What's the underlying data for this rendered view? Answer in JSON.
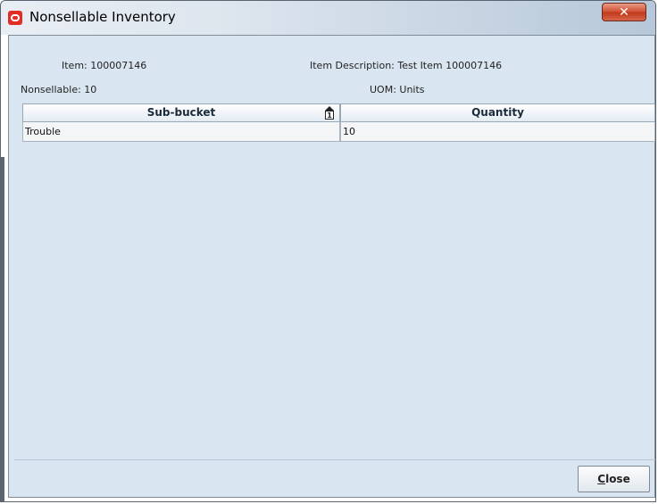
{
  "window": {
    "title": "Nonsellable Inventory",
    "close_glyph": "✕"
  },
  "fields": {
    "item_label": "Item:",
    "item_value": "100007146",
    "nonsellable_label": "Nonsellable:",
    "nonsellable_value": "10",
    "item_description_label": "Item Description:",
    "item_description_value": "Test Item 100007146",
    "uom_label": "UOM:",
    "uom_value": "Units"
  },
  "table": {
    "columns": [
      "Sub-bucket",
      "Quantity"
    ],
    "sort_indicator": "1",
    "rows": [
      {
        "sub_bucket": "Trouble",
        "quantity": "10"
      }
    ]
  },
  "footer": {
    "close_button_label": "Close",
    "close_button_mnemonic": "C",
    "close_button_rest": "lose"
  },
  "colors": {
    "accent": "#e32c24",
    "panel_background": "#d9e6f1"
  }
}
